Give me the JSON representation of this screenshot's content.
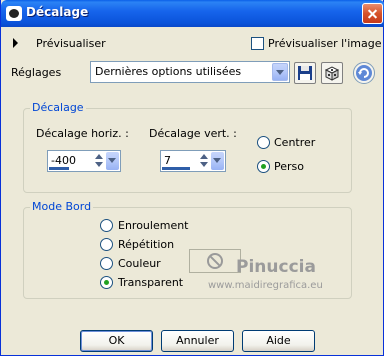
{
  "window": {
    "title": "Décalage"
  },
  "preview": {
    "label": "Prévisualiser",
    "checkbox_label": "Prévisualiser l'image"
  },
  "settings": {
    "label": "Réglages",
    "selected": "Dernières options utilisées"
  },
  "offset_group": {
    "title": "Décalage",
    "horiz_label": "Décalage horiz. :",
    "horiz_value": "-400",
    "vert_label": "Décalage vert. :",
    "vert_value": "7",
    "radio_center": "Centrer",
    "radio_custom": "Perso",
    "selected": "Perso"
  },
  "mode_group": {
    "title": "Mode Bord",
    "options": [
      "Enroulement",
      "Répétition",
      "Couleur",
      "Transparent"
    ],
    "selected": "Transparent"
  },
  "watermark": {
    "name": "Pinuccia",
    "url": "www.maidiregrafica.eu"
  },
  "buttons": {
    "ok": "OK",
    "cancel": "Annuler",
    "help": "Aide"
  },
  "colors": {
    "title_bar": "#0B53DA",
    "group_title": "#0046D5",
    "radio_selected": "#21A121",
    "dialog_bg": "#ECE9D8"
  }
}
